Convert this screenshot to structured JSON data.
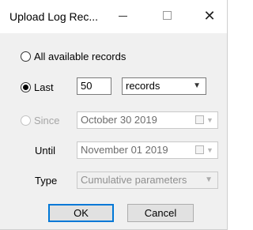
{
  "window": {
    "title": "Upload Log Rec...",
    "close_glyph": "✕"
  },
  "options": {
    "all_label": "All available records",
    "last_label": "Last",
    "since_label": "Since",
    "selected": "last"
  },
  "last": {
    "count": "50",
    "unit": "records"
  },
  "since": {
    "date": "October   30 2019"
  },
  "until": {
    "label": "Until",
    "date": "November 01 2019"
  },
  "type": {
    "label": "Type",
    "value": "Cumulative parameters"
  },
  "buttons": {
    "ok": "OK",
    "cancel": "Cancel"
  },
  "icons": {
    "dropdown": "▼",
    "minimize": "minimize-icon",
    "maximize": "maximize-icon",
    "close": "close-icon",
    "calendar": "calendar-icon"
  }
}
